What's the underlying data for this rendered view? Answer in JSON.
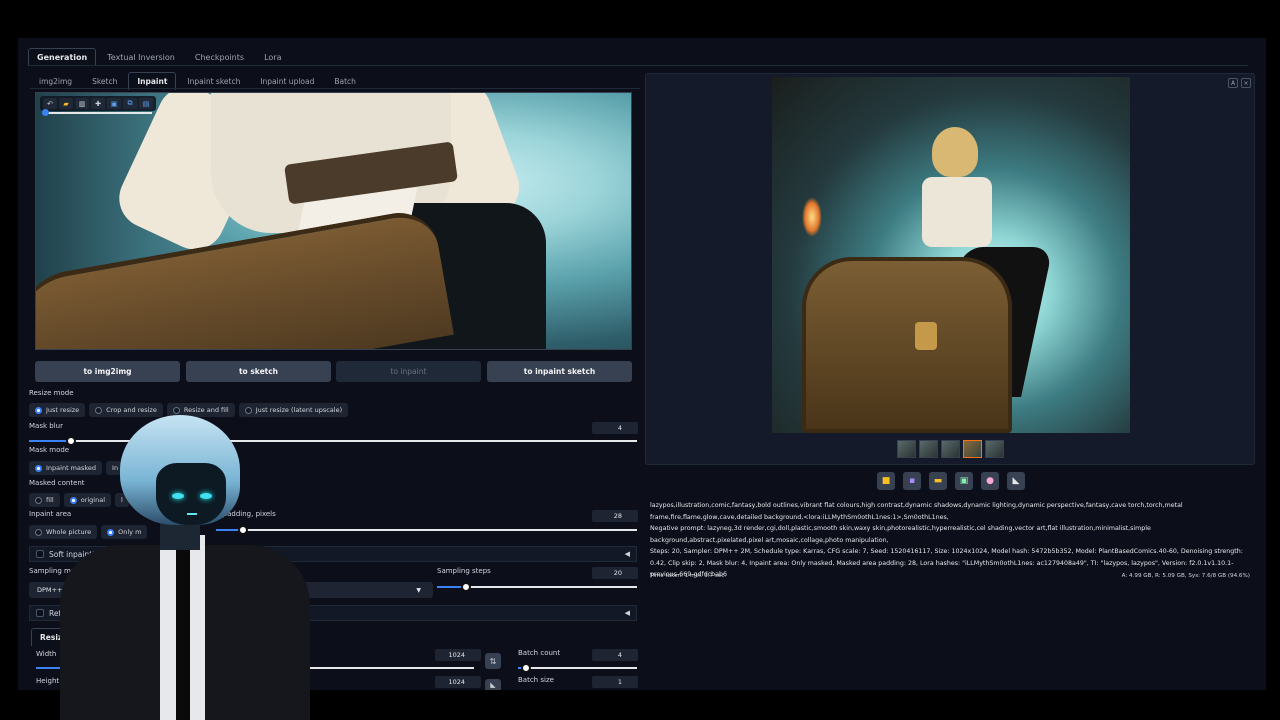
{
  "main_tabs": [
    {
      "label": "Generation",
      "active": true
    },
    {
      "label": "Textual Inversion"
    },
    {
      "label": "Checkpoints"
    },
    {
      "label": "Lora"
    }
  ],
  "sub_tabs": [
    {
      "label": "img2img"
    },
    {
      "label": "Sketch"
    },
    {
      "label": "Inpaint",
      "active": true
    },
    {
      "label": "Inpaint sketch"
    },
    {
      "label": "Inpaint upload"
    },
    {
      "label": "Batch"
    }
  ],
  "brush_tools": [
    "undo-icon",
    "folder-icon",
    "trash-icon",
    "brush-icon",
    "image-icon",
    "copy-icon",
    "tool-icon"
  ],
  "send_buttons": {
    "img2img": "to img2img",
    "sketch": "to sketch",
    "inpaint": "to inpaint",
    "inpaint_sketch": "to inpaint sketch"
  },
  "resize_mode": {
    "label": "Resize mode",
    "options": [
      "Just resize",
      "Crop and resize",
      "Resize and fill",
      "Just resize (latent upscale)"
    ],
    "selected": "Just resize"
  },
  "mask_blur": {
    "label": "Mask blur",
    "value": "4",
    "min": 0,
    "max": 64
  },
  "mask_mode": {
    "label": "Mask mode",
    "options": [
      "Inpaint masked",
      "In"
    ],
    "selected": "Inpaint masked"
  },
  "masked_content": {
    "label": "Masked content",
    "options": [
      "fill",
      "original",
      "l",
      "g"
    ],
    "selected": "original"
  },
  "inpaint_area": {
    "label": "Inpaint area",
    "options": [
      "Whole picture",
      "Only m"
    ],
    "selected": "Only m",
    "padding_label": "d padding, pixels",
    "padding_value": "28",
    "padding_max": 256
  },
  "soft_inpainting": {
    "label": "Soft inpainting",
    "arrow": "◀"
  },
  "sampling_method": {
    "label": "Sampling method",
    "value": "DPM++ 2M",
    "type_label": "pe"
  },
  "sampling_steps": {
    "label": "Sampling steps",
    "value": "20",
    "min": 1,
    "max": 150
  },
  "refiner": {
    "label": "Refiner",
    "arrow": "◀"
  },
  "resize_to": {
    "tab_label": "Resize to",
    "width_label": "Width",
    "width_value": "1024",
    "height_label": "Height",
    "height_value": "1024"
  },
  "batch_count": {
    "label": "Batch count",
    "value": "4"
  },
  "batch_size": {
    "label": "Batch size",
    "value": "1"
  },
  "output_controls": [
    "A",
    "×"
  ],
  "thumbnails": {
    "count": 5,
    "selected_index": 3
  },
  "output_tools": [
    "folder-icon",
    "save-icon",
    "zip-icon",
    "send-img2img-icon",
    "send-inpaint-icon",
    "send-extras-icon"
  ],
  "gen_info": {
    "positive": "lazypos,illustration,comic,fantasy,bold outlines,vibrant flat colours,high contrast,dynamic shadows,dynamic lighting,dynamic perspective,fantasy,cave torch,torch,metal frame,fire,flame,glow,cave,detailed background,<lora:iLLMythSm0othL1nes:1>,Sm0othL1nes,",
    "negative": "Negative prompt: lazyneg,3d render,cgi,doll,plastic,smooth skin,waxy skin,photorealistic,hyperrealistic,cel shading,vector art,flat illustration,minimalist,simple background,abstract,pixelated,pixel art,mosaic,collage,photo manipulation,",
    "params": "Steps: 20, Sampler: DPM++ 2M, Schedule type: Karras, CFG scale: 7, Seed: 1520416117, Size: 1024x1024, Model hash: 5472b5b352, Model: PlantBasedComics.40-60, Denoising strength: 0.42, Clip skip: 2, Mask blur: 4, Inpaint area: Only masked, Masked area padding: 28, Lora hashes: \"iLLMythSm0othL1nes: ac1279408a49\", TI: \"lazypos, lazypos\", Version: f2.0.1v1.10.1-previous-669-gdfdcbab6",
    "time_taken": "Time taken: 1 min. 3.7 sec.",
    "vram": "A: 4.99 GB, R: 5.09 GB, Sys: 7.6/8 GB (94.6%)"
  }
}
